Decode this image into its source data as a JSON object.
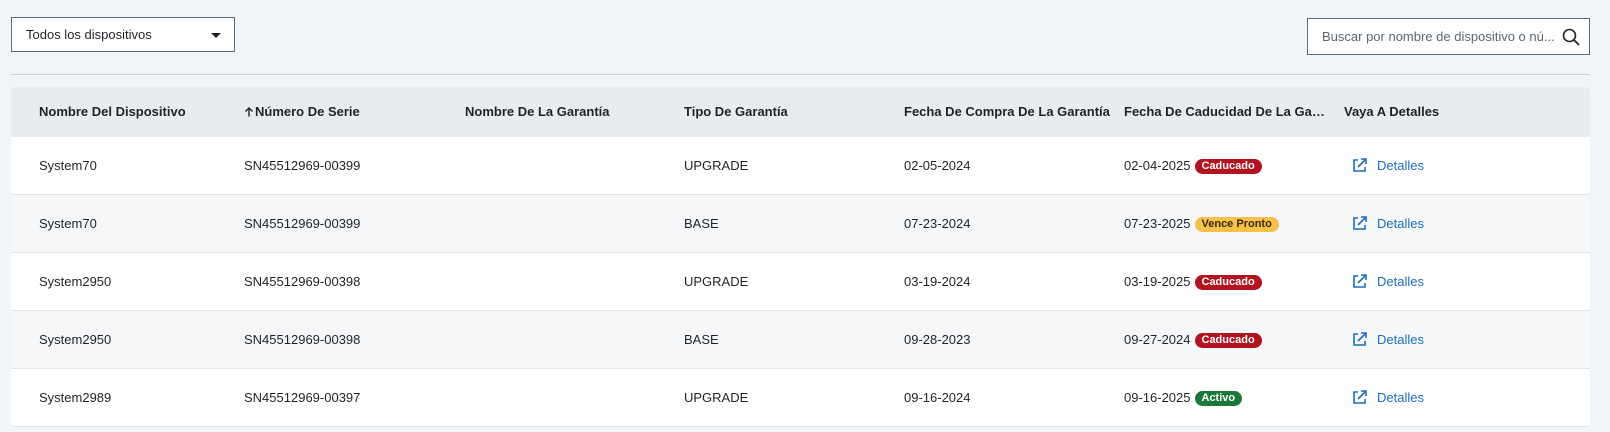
{
  "filter": {
    "selected": "Todos los dispositivos"
  },
  "search": {
    "placeholder": "Buscar por nombre de dispositivo o nú..."
  },
  "table": {
    "columns": [
      "Nombre Del Dispositivo",
      "Número De Serie",
      "Nombre De La Garantía",
      "Tipo De Garantía",
      "Fecha De Compra De La Garantía",
      "Fecha De Caducidad De La Garan...",
      "Vaya A Detalles"
    ],
    "sorted_column": "Número De Serie",
    "rows": [
      {
        "device": "System70",
        "serial": "SN45512969-00399",
        "warranty_name": "",
        "type": "UPGRADE",
        "purchase": "02-05-2024",
        "expiry": "02-04-2025",
        "status": "Caducado",
        "link": "Detalles"
      },
      {
        "device": "System70",
        "serial": "SN45512969-00399",
        "warranty_name": "",
        "type": "BASE",
        "purchase": "07-23-2024",
        "expiry": "07-23-2025",
        "status": "Vence Pronto",
        "link": "Detalles"
      },
      {
        "device": "System2950",
        "serial": "SN45512969-00398",
        "warranty_name": "",
        "type": "UPGRADE",
        "purchase": "03-19-2024",
        "expiry": "03-19-2025",
        "status": "Caducado",
        "link": "Detalles"
      },
      {
        "device": "System2950",
        "serial": "SN45512969-00398",
        "warranty_name": "",
        "type": "BASE",
        "purchase": "09-28-2023",
        "expiry": "09-27-2024",
        "status": "Caducado",
        "link": "Detalles"
      },
      {
        "device": "System2989",
        "serial": "SN45512969-00397",
        "warranty_name": "",
        "type": "UPGRADE",
        "purchase": "09-16-2024",
        "expiry": "09-16-2025",
        "status": "Activo",
        "link": "Detalles"
      }
    ]
  },
  "status_colors": {
    "Caducado": "#b3121f",
    "Vence Pronto": "#f6c14a",
    "Activo": "#1b7a3a"
  },
  "icons": {
    "dropdown": "chevron-down-icon",
    "search": "search-icon",
    "link": "external-link-icon",
    "sort": "arrow-up-icon"
  }
}
